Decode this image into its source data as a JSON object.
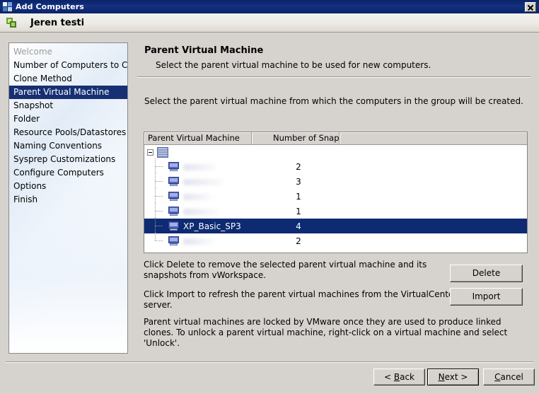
{
  "window": {
    "title": "Add Computers",
    "icon": "computers-icon",
    "close_label": "Close"
  },
  "header": {
    "text": "Jeren testi",
    "icon": "linked-squares-icon"
  },
  "sidebar": {
    "items": [
      {
        "label": "Welcome",
        "state": "done"
      },
      {
        "label": "Number of Computers to Create",
        "state": "normal"
      },
      {
        "label": "Clone Method",
        "state": "normal"
      },
      {
        "label": "Parent Virtual Machine",
        "state": "active"
      },
      {
        "label": "Snapshot",
        "state": "normal"
      },
      {
        "label": "Folder",
        "state": "normal"
      },
      {
        "label": "Resource Pools/Datastores",
        "state": "normal"
      },
      {
        "label": "Naming Conventions",
        "state": "normal"
      },
      {
        "label": "Sysprep Customizations",
        "state": "normal"
      },
      {
        "label": "Configure Computers",
        "state": "normal"
      },
      {
        "label": "Options",
        "state": "normal"
      },
      {
        "label": "Finish",
        "state": "normal"
      }
    ]
  },
  "main": {
    "title": "Parent Virtual Machine",
    "subtitle": "Select the parent virtual machine to be used for new computers.",
    "intro": "Select the parent virtual machine from which the computers in the group will be created.",
    "table": {
      "columns": [
        "Parent Virtual Machine",
        "Number of Snapshots",
        ""
      ],
      "root": {
        "icon": "datacenter-building-icon",
        "label": "",
        "expanded": true
      },
      "rows": [
        {
          "name": "",
          "redacted": true,
          "snapshots": "2",
          "selected": false
        },
        {
          "name": "",
          "redacted": true,
          "snapshots": "3",
          "selected": false
        },
        {
          "name": "",
          "redacted": true,
          "snapshots": "1",
          "selected": false
        },
        {
          "name": "",
          "redacted": true,
          "snapshots": "1",
          "selected": false
        },
        {
          "name": "XP_Basic_SP3",
          "redacted": false,
          "snapshots": "4",
          "selected": true
        },
        {
          "name": "",
          "redacted": true,
          "snapshots": "2",
          "selected": false
        }
      ]
    },
    "notes": {
      "delete_note": "Click Delete to remove the selected parent virtual machine and its snapshots from vWorkspace.",
      "import_note": "Click Import to refresh the parent virtual machines from the VirtualCenter server.",
      "lock_note": "Parent virtual machines are locked by VMware once they are used to produce linked clones.  To unlock a parent virtual machine, right-click on a virtual machine and select 'Unlock'."
    },
    "buttons": {
      "delete": "Delete",
      "import": "Import"
    }
  },
  "footer": {
    "back": "< Back",
    "next": "Next >",
    "cancel": "Cancel"
  },
  "colors": {
    "titlebar": "#0a246a",
    "selection": "#163073",
    "row_selection": "#0e2a72",
    "dialog_face": "#d6d3ce"
  }
}
